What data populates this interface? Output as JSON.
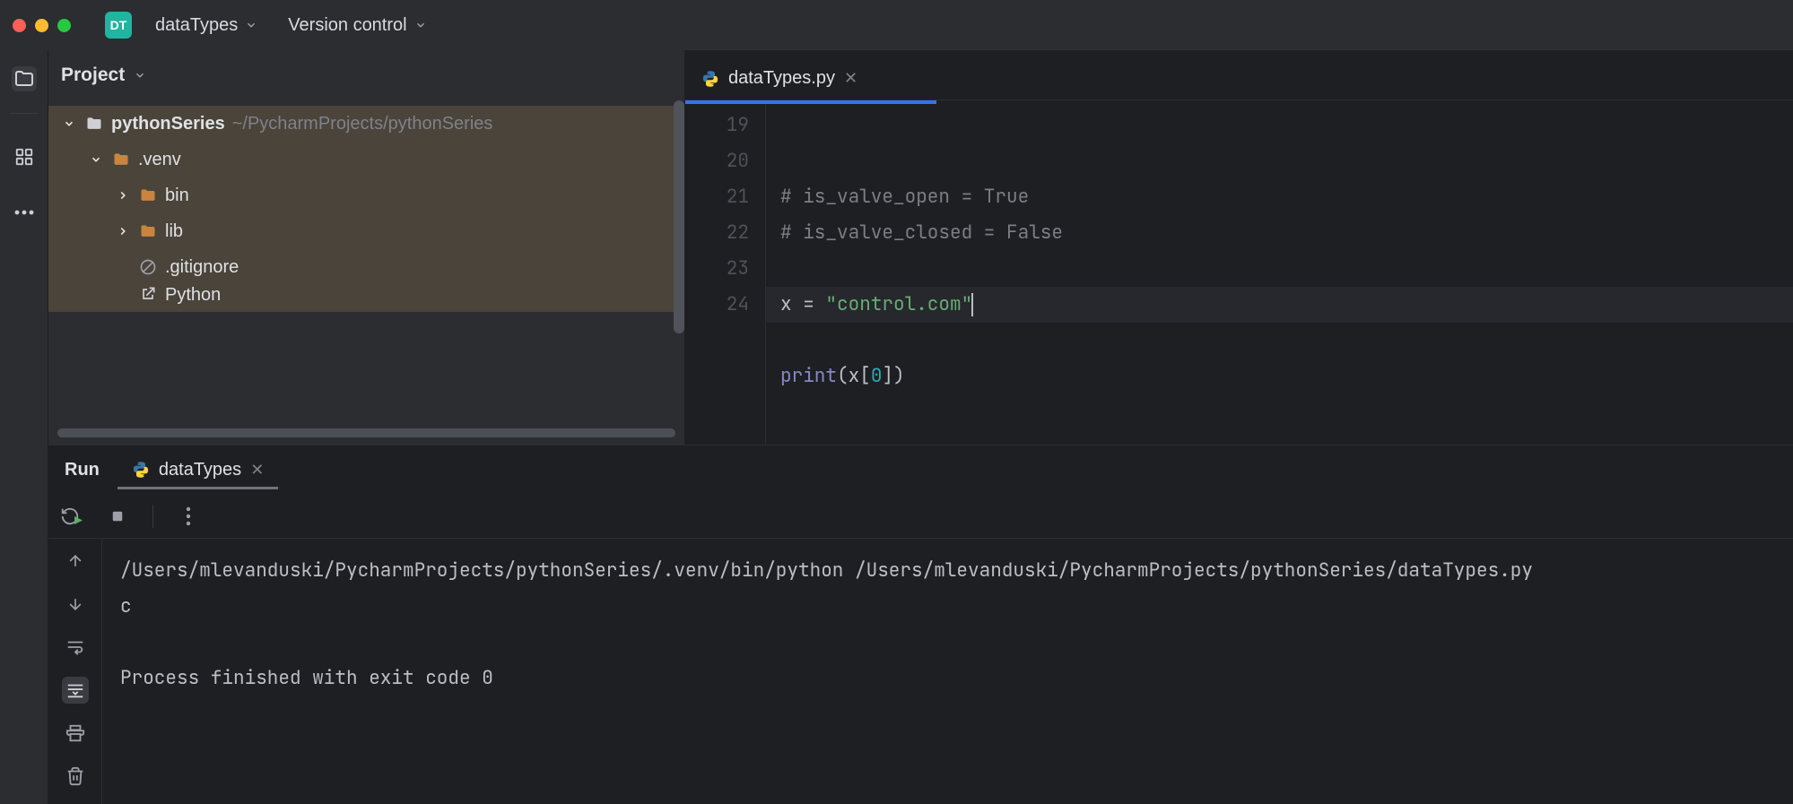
{
  "titlebar": {
    "badge": "DT",
    "project_name": "dataTypes",
    "vcs_label": "Version control"
  },
  "project_panel": {
    "title": "Project",
    "root": {
      "name": "pythonSeries",
      "path": "~/PycharmProjects/pythonSeries"
    },
    "venv_name": ".venv",
    "bin_name": "bin",
    "lib_name": "lib",
    "gitignore": ".gitignore",
    "python_link": "Python"
  },
  "editor": {
    "tab_name": "dataTypes.py",
    "lines": {
      "l19": "",
      "l20_a": "# is_valve_open = True",
      "l21_a": "# is_valve_closed = False",
      "l22": "",
      "l23_var": "x = ",
      "l23_str": "\"control.com\"",
      "l24_fn": "print",
      "l24_open": "(x[",
      "l24_idx": "0",
      "l24_close": "])"
    },
    "ln": {
      "n19": "19",
      "n20": "20",
      "n21": "21",
      "n22": "22",
      "n23": "23",
      "n24": "24"
    }
  },
  "run": {
    "label": "Run",
    "tab_name": "dataTypes",
    "cmd": "/Users/mlevanduski/PycharmProjects/pythonSeries/.venv/bin/python /Users/mlevanduski/PycharmProjects/pythonSeries/dataTypes.py",
    "stdout": "c",
    "exit_msg": "Process finished with exit code 0"
  }
}
